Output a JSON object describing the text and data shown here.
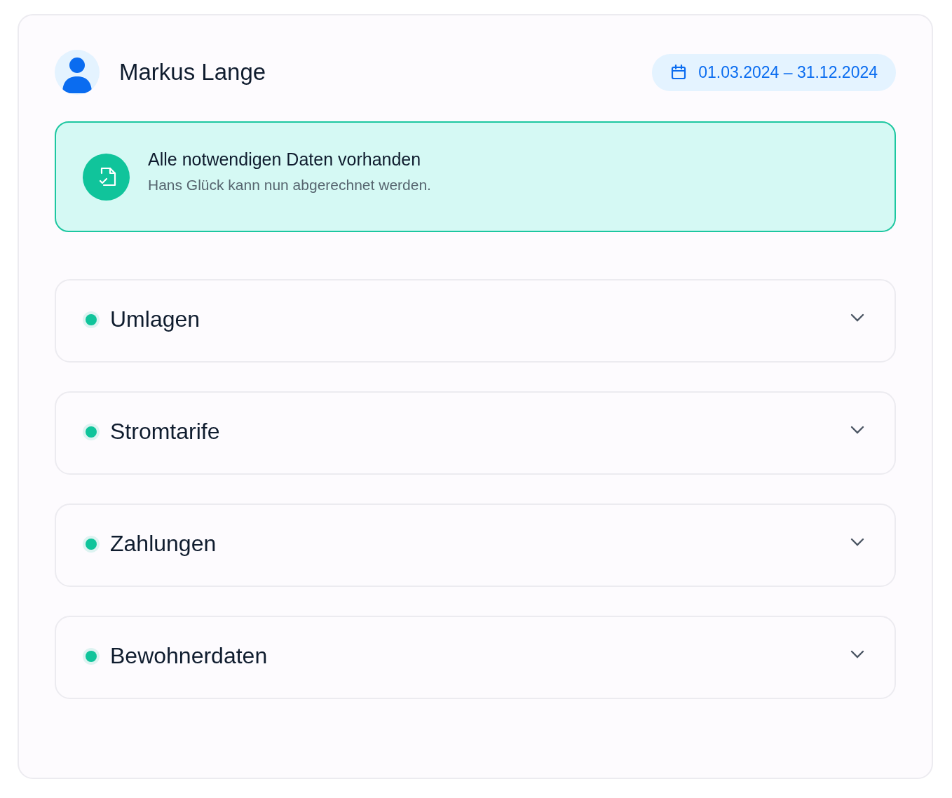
{
  "person": {
    "name": "Markus Lange"
  },
  "period": {
    "label": "01.03.2024 – 31.12.2024"
  },
  "banner": {
    "title": "Alle notwendigen Daten vorhanden",
    "message": "Hans Glück kann nun abgerechnet werden."
  },
  "sections": [
    {
      "title": "Umlagen",
      "color": "#10c49b",
      "expanded": false
    },
    {
      "title": "Stromtarife",
      "color": "#10c49b",
      "expanded": false
    },
    {
      "title": "Zahlungen",
      "color": "#10c49b",
      "expanded": false
    },
    {
      "title": "Bewohnerdaten",
      "color": "#10c49b",
      "expanded": false
    }
  ]
}
